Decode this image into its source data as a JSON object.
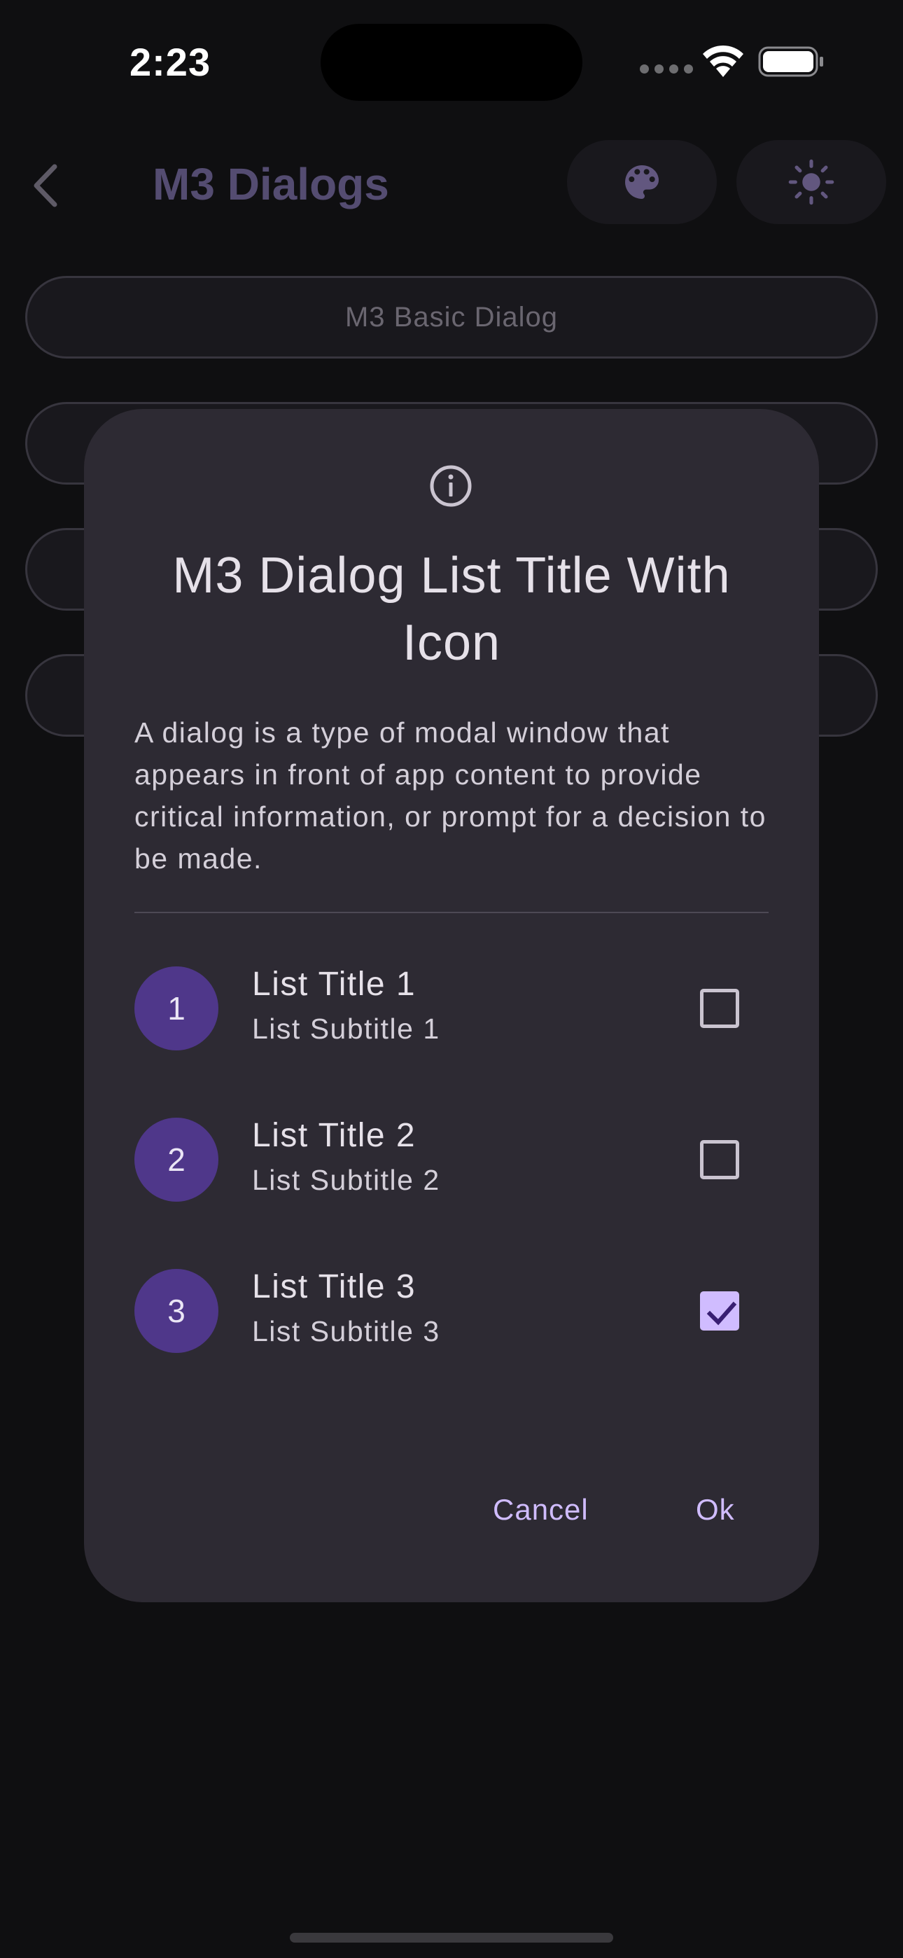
{
  "status_bar": {
    "time": "2:23"
  },
  "app_bar": {
    "title": "M3 Dialogs",
    "icons": [
      "back-arrow",
      "palette",
      "brightness"
    ]
  },
  "background_buttons": [
    {
      "label": "M3 Basic Dialog"
    }
  ],
  "dialog": {
    "icon": "info",
    "title": "M3 Dialog List Title With Icon",
    "body": "A dialog is a type of modal window that appears in front of app content to provide critical information, or prompt for a decision to be made.",
    "items": [
      {
        "number": "1",
        "title": "List Title 1",
        "subtitle": "List Subtitle 1",
        "checked": false
      },
      {
        "number": "2",
        "title": "List Title 2",
        "subtitle": "List Subtitle 2",
        "checked": false
      },
      {
        "number": "3",
        "title": "List Title 3",
        "subtitle": "List Subtitle 3",
        "checked": true
      }
    ],
    "actions": {
      "cancel": "Cancel",
      "ok": "Ok"
    }
  },
  "colors": {
    "background": "#0f0f11",
    "dialog_surface": "#2d2a33",
    "primary": "#d0bcff",
    "avatar": "#4f378a",
    "dimmed_title": "#544c71"
  }
}
